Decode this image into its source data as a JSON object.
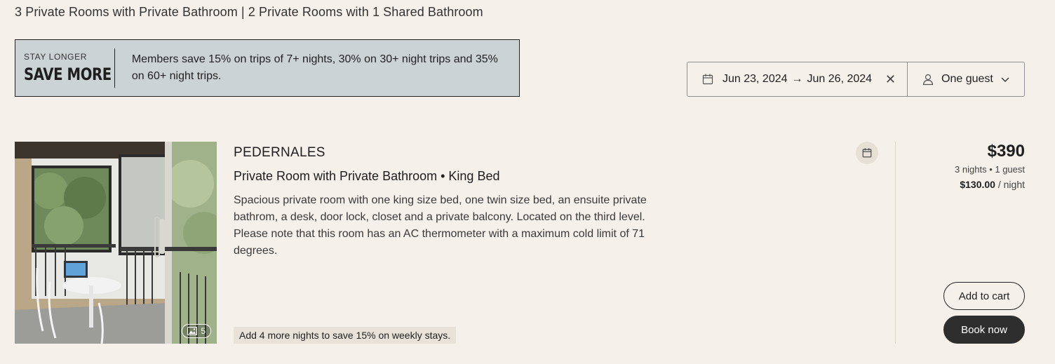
{
  "summary": "3 Private Rooms with Private Bathroom | 2 Private Rooms with 1 Shared Bathroom",
  "promo": {
    "eyebrow": "STAY LONGER",
    "headline": "SAVE MORE",
    "text": "Members save 15% on trips of 7+ nights, 30% on 30+ night trips and 35% on 60+ night trips."
  },
  "search": {
    "check_in": "Jun 23, 2024",
    "check_out": "Jun 26, 2024",
    "arrow": "→",
    "clear": "✕",
    "guests": "One guest",
    "icons": [
      "calendar-icon",
      "close-icon",
      "person-icon",
      "chevron-down-icon"
    ]
  },
  "room": {
    "name": "PEDERNALES",
    "type": "Private Room with Private Bathroom • King Bed",
    "description": "Spacious private room with one king size bed, one twin size bed, an ensuite private bathrom, a desk, door lock, closet and a private balcony. Located on the third level. Please note that this room has an AC thermometer with a maximum cold limit of 71 degrees.",
    "photo_count": "5",
    "upsell": "Add 4 more nights to save 15% on weekly stays."
  },
  "pricing": {
    "total": "$390",
    "nights_guests": "3 nights • 1 guest",
    "nightly_price": "$130.00",
    "nightly_suffix": " / night"
  },
  "actions": {
    "add_to_cart": "Add to cart",
    "book_now": "Book now"
  },
  "colors": {
    "background": "#f5f0e9",
    "promo_bg": "#ccd3d5",
    "dark_button": "#2e2e2e"
  }
}
